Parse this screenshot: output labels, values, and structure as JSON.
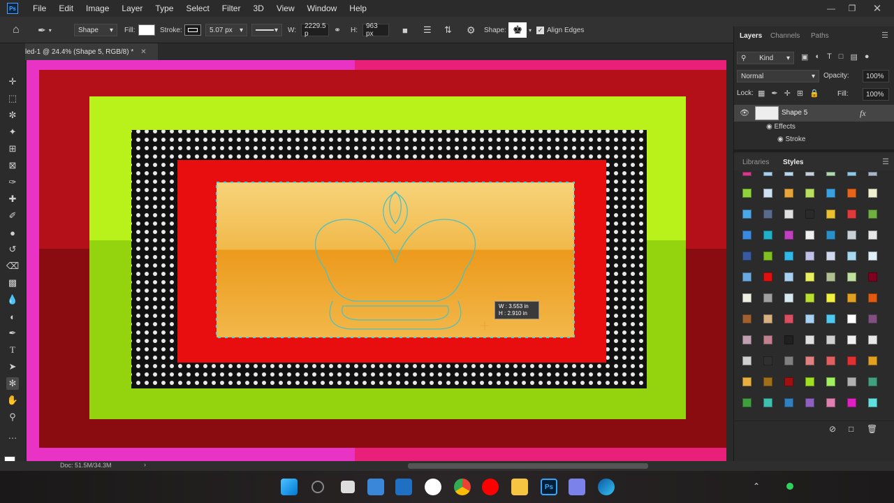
{
  "app": {
    "logo_text": "Ps"
  },
  "menu": [
    "File",
    "Edit",
    "Image",
    "Layer",
    "Type",
    "Select",
    "Filter",
    "3D",
    "View",
    "Window",
    "Help"
  ],
  "options": {
    "mode": "Shape",
    "fill_label": "Fill:",
    "stroke_label": "Stroke:",
    "stroke_width": "5.07 px",
    "w_label": "W:",
    "w_value": "2229.5 p",
    "h_label": "H:",
    "h_value": "963 px",
    "shape_label": "Shape:",
    "align_edges": "Align Edges"
  },
  "document": {
    "tab_title": "led-1 @ 24.4% (Shape 5, RGB/8) *"
  },
  "canvas": {
    "tooltip_w": "W :  3.553 in",
    "tooltip_h": "H :  2.910 in"
  },
  "layers_panel": {
    "tabs": [
      "Layers",
      "Channels",
      "Paths"
    ],
    "filter_kind": "Kind",
    "blend_mode": "Normal",
    "opacity_label": "Opacity:",
    "opacity_value": "100%",
    "lock_label": "Lock:",
    "fill_label": "Fill:",
    "fill_value": "100%",
    "layer_name": "Shape 5",
    "fx_label": "fx",
    "effects_label": "Effects",
    "stroke_effect": "Stroke"
  },
  "styles_panel": {
    "tabs": [
      "Libraries",
      "Styles"
    ],
    "swatches": [
      [
        "#d23a8a",
        "#a8d0ec",
        "#b8d8f0",
        "#c8d0dc",
        "#b0d8b0",
        "#90c8e8",
        "#a8b8c8"
      ],
      [
        "#8fd43a",
        "#cfe0f4",
        "#e8a43a",
        "#b8e060",
        "#3aa0e0",
        "#e8641a",
        "#f0f0d0"
      ],
      [
        "#4aa8e8",
        "#5a6a8a",
        "#e0e0e0",
        "#2a2a2a",
        "#e8c030",
        "#e03a3a",
        "#70b040"
      ],
      [
        "#3a8ae0",
        "#20b0c8",
        "#c040c0",
        "#f0f0f0",
        "#2a90c8",
        "#c8d0d8",
        "#e8e8e8"
      ],
      [
        "#3a5aa0",
        "#80c020",
        "#30b8e8",
        "#c0c0e8",
        "#d0d8f0",
        "#a8d8f0",
        "#e0f0f8"
      ],
      [
        "#6aa8e0",
        "#e01010",
        "#a8d0f0",
        "#e8f060",
        "#b0c090",
        "#c0e0a0",
        "#800020"
      ],
      [
        "#f0f0e0",
        "#a0a0a0",
        "#d8e8f0",
        "#b8e030",
        "#f0f040",
        "#e0a020",
        "#e05a10"
      ],
      [
        "#a06030",
        "#d8b080",
        "#d85060",
        "#a8d0f0",
        "#50c8f0",
        "#ffffff",
        "#805080"
      ],
      [
        "#c0a0b0",
        "#c08090",
        "#202020",
        "#e0e0e0",
        "#d0d0d0",
        "#f0f0f0",
        "#e8e8e8"
      ],
      [
        "#d0d0d0",
        "#303030",
        "#808080",
        "#e08080",
        "#e06060",
        "#e03030",
        "#e0a020"
      ],
      [
        "#e8b040",
        "#a07018",
        "#a01010",
        "#a0e020",
        "#a0f060",
        "#b0b0b0",
        "#40a080"
      ],
      [
        "#40a040",
        "#40c0b0",
        "#3080c0",
        "#9060c0",
        "#e080b0",
        "#e020c0",
        "#60e0e0"
      ]
    ]
  },
  "status": {
    "doc_size": "Doc: 51.5M/34.3M"
  }
}
